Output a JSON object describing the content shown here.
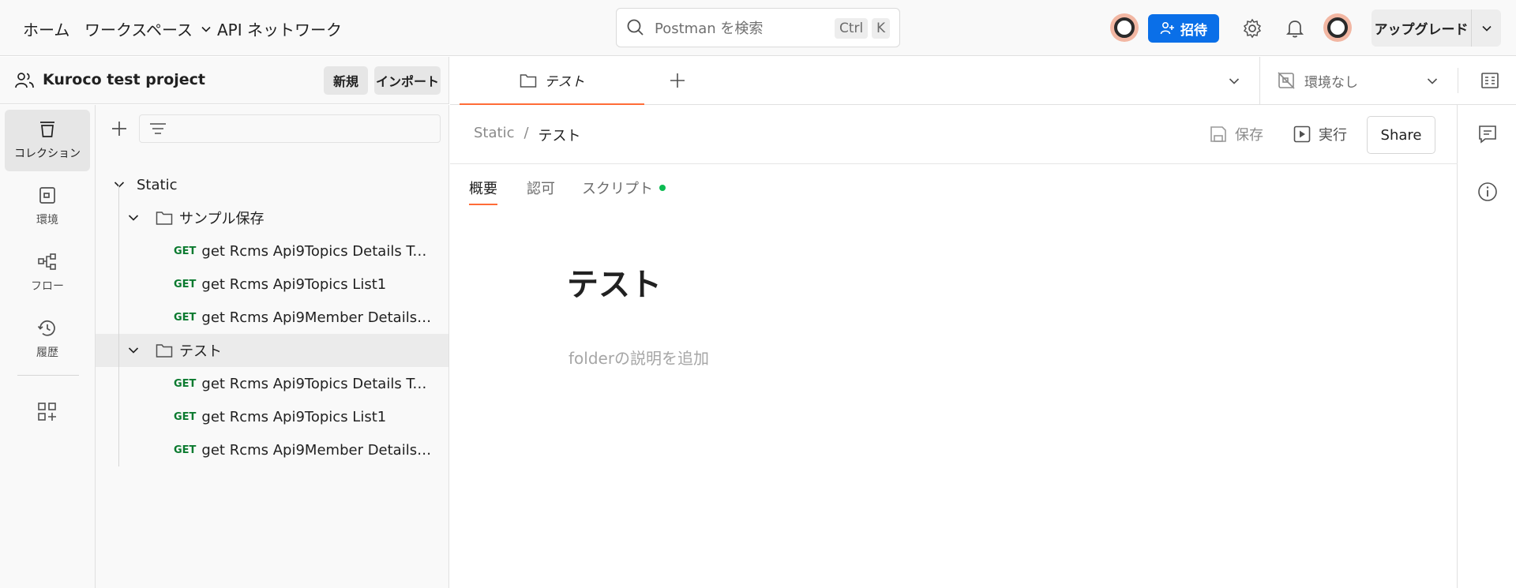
{
  "colors": {
    "accent": "#ff6c37",
    "primary_button": "#0a6fe8",
    "get_method": "#0b7a2f",
    "status_dot": "#0cbb52"
  },
  "topbar": {
    "nav": [
      "ホーム",
      "ワークスペース",
      "API ネットワーク"
    ],
    "search_placeholder": "Postman を検索",
    "shortcut_ctrl": "Ctrl",
    "shortcut_k": "K",
    "invite_label": "招待",
    "upgrade_label": "アップグレード",
    "icons": [
      "chevron-down-icon",
      "search-icon",
      "user-plus-icon",
      "gear-icon",
      "bell-icon"
    ]
  },
  "workspace": {
    "title": "Kuroco test project",
    "new_label": "新規",
    "import_label": "インポート"
  },
  "rail": {
    "items": [
      {
        "label": "コレクション",
        "icon": "collections-icon"
      },
      {
        "label": "環境",
        "icon": "environment-icon"
      },
      {
        "label": "フロー",
        "icon": "flows-icon"
      },
      {
        "label": "履歴",
        "icon": "history-icon"
      }
    ]
  },
  "tree": {
    "collection": "Static",
    "folders": [
      {
        "name": "サンプル保存",
        "requests": [
          {
            "method": "GET",
            "name": "get Rcms Api9Topics Details Top..."
          },
          {
            "method": "GET",
            "name": "get Rcms Api9Topics List1"
          },
          {
            "method": "GET",
            "name": "get Rcms Api9Member Details M..."
          }
        ]
      },
      {
        "name": "テスト",
        "requests": [
          {
            "method": "GET",
            "name": "get Rcms Api9Topics Details Top..."
          },
          {
            "method": "GET",
            "name": "get Rcms Api9Topics List1"
          },
          {
            "method": "GET",
            "name": "get Rcms Api9Member Details M..."
          }
        ]
      }
    ]
  },
  "tabs": {
    "open_tab": "テスト",
    "environment": "環境なし"
  },
  "main": {
    "breadcrumb": [
      "Static",
      "/",
      "テスト"
    ],
    "save_label": "保存",
    "run_label": "実行",
    "share_label": "Share",
    "subtabs": [
      "概要",
      "認可",
      "スクリプト"
    ],
    "title": "テスト",
    "description_placeholder": "folderの説明を追加"
  }
}
